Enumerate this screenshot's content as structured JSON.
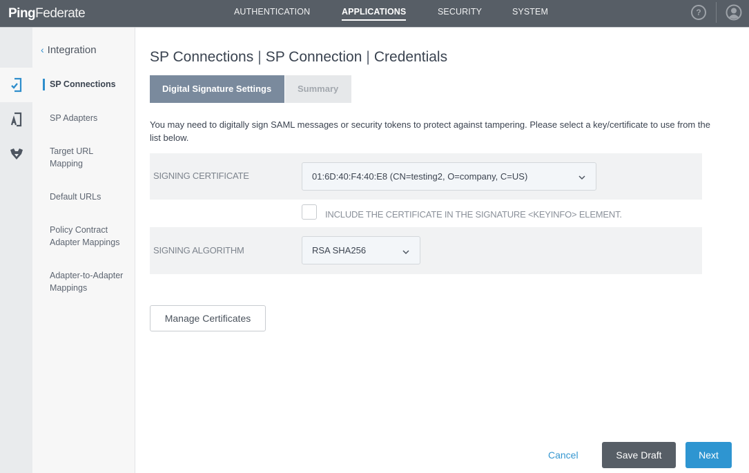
{
  "app": {
    "logo_bold": "Ping",
    "logo_light": "Federate"
  },
  "topnav": {
    "items": [
      {
        "label": "AUTHENTICATION",
        "active": false
      },
      {
        "label": "APPLICATIONS",
        "active": true
      },
      {
        "label": "SECURITY",
        "active": false
      },
      {
        "label": "SYSTEM",
        "active": false
      }
    ],
    "help_icon_glyph": "?",
    "icons": [
      "help-icon",
      "user-avatar-icon"
    ]
  },
  "rail": {
    "items": [
      {
        "icon": "sp-connection-icon",
        "active": true,
        "color": "#2e8ecc"
      },
      {
        "icon": "application-icon",
        "active": false
      },
      {
        "icon": "oauth-icon",
        "active": false
      }
    ]
  },
  "sidebar": {
    "back_label": "Integration",
    "items": [
      {
        "label": "SP Connections",
        "active": true
      },
      {
        "label": "SP Adapters",
        "active": false
      },
      {
        "label": "Target URL Mapping",
        "active": false
      },
      {
        "label": "Default URLs",
        "active": false
      },
      {
        "label": "Policy Contract Adapter Mappings",
        "active": false
      },
      {
        "label": "Adapter-to-Adapter Mappings",
        "active": false
      }
    ]
  },
  "page": {
    "breadcrumb": [
      "SP Connections",
      "SP Connection",
      "Credentials"
    ],
    "separator": "|",
    "tabs": [
      {
        "label": "Digital Signature Settings",
        "active": true
      },
      {
        "label": "Summary",
        "active": false
      }
    ],
    "description": "You may need to digitally sign SAML messages or security tokens to protect against tampering. Please select a key/certificate to use from the list below."
  },
  "form": {
    "signing_certificate": {
      "label": "SIGNING CERTIFICATE",
      "value": "01:6D:40:F4:40:E8 (CN=testing2, O=company, C=US)"
    },
    "include_certificate": {
      "label": "INCLUDE THE CERTIFICATE IN THE SIGNATURE <KEYINFO> ELEMENT.",
      "checked": false
    },
    "signing_algorithm": {
      "label": "SIGNING ALGORITHM",
      "value": "RSA SHA256"
    },
    "manage_certificates_label": "Manage Certificates"
  },
  "footer": {
    "cancel_label": "Cancel",
    "save_draft_label": "Save Draft",
    "next_label": "Next"
  },
  "colors": {
    "topbar": "#575e66",
    "accent_blue": "#2e95d1",
    "active_tab": "#7a8a9d"
  }
}
